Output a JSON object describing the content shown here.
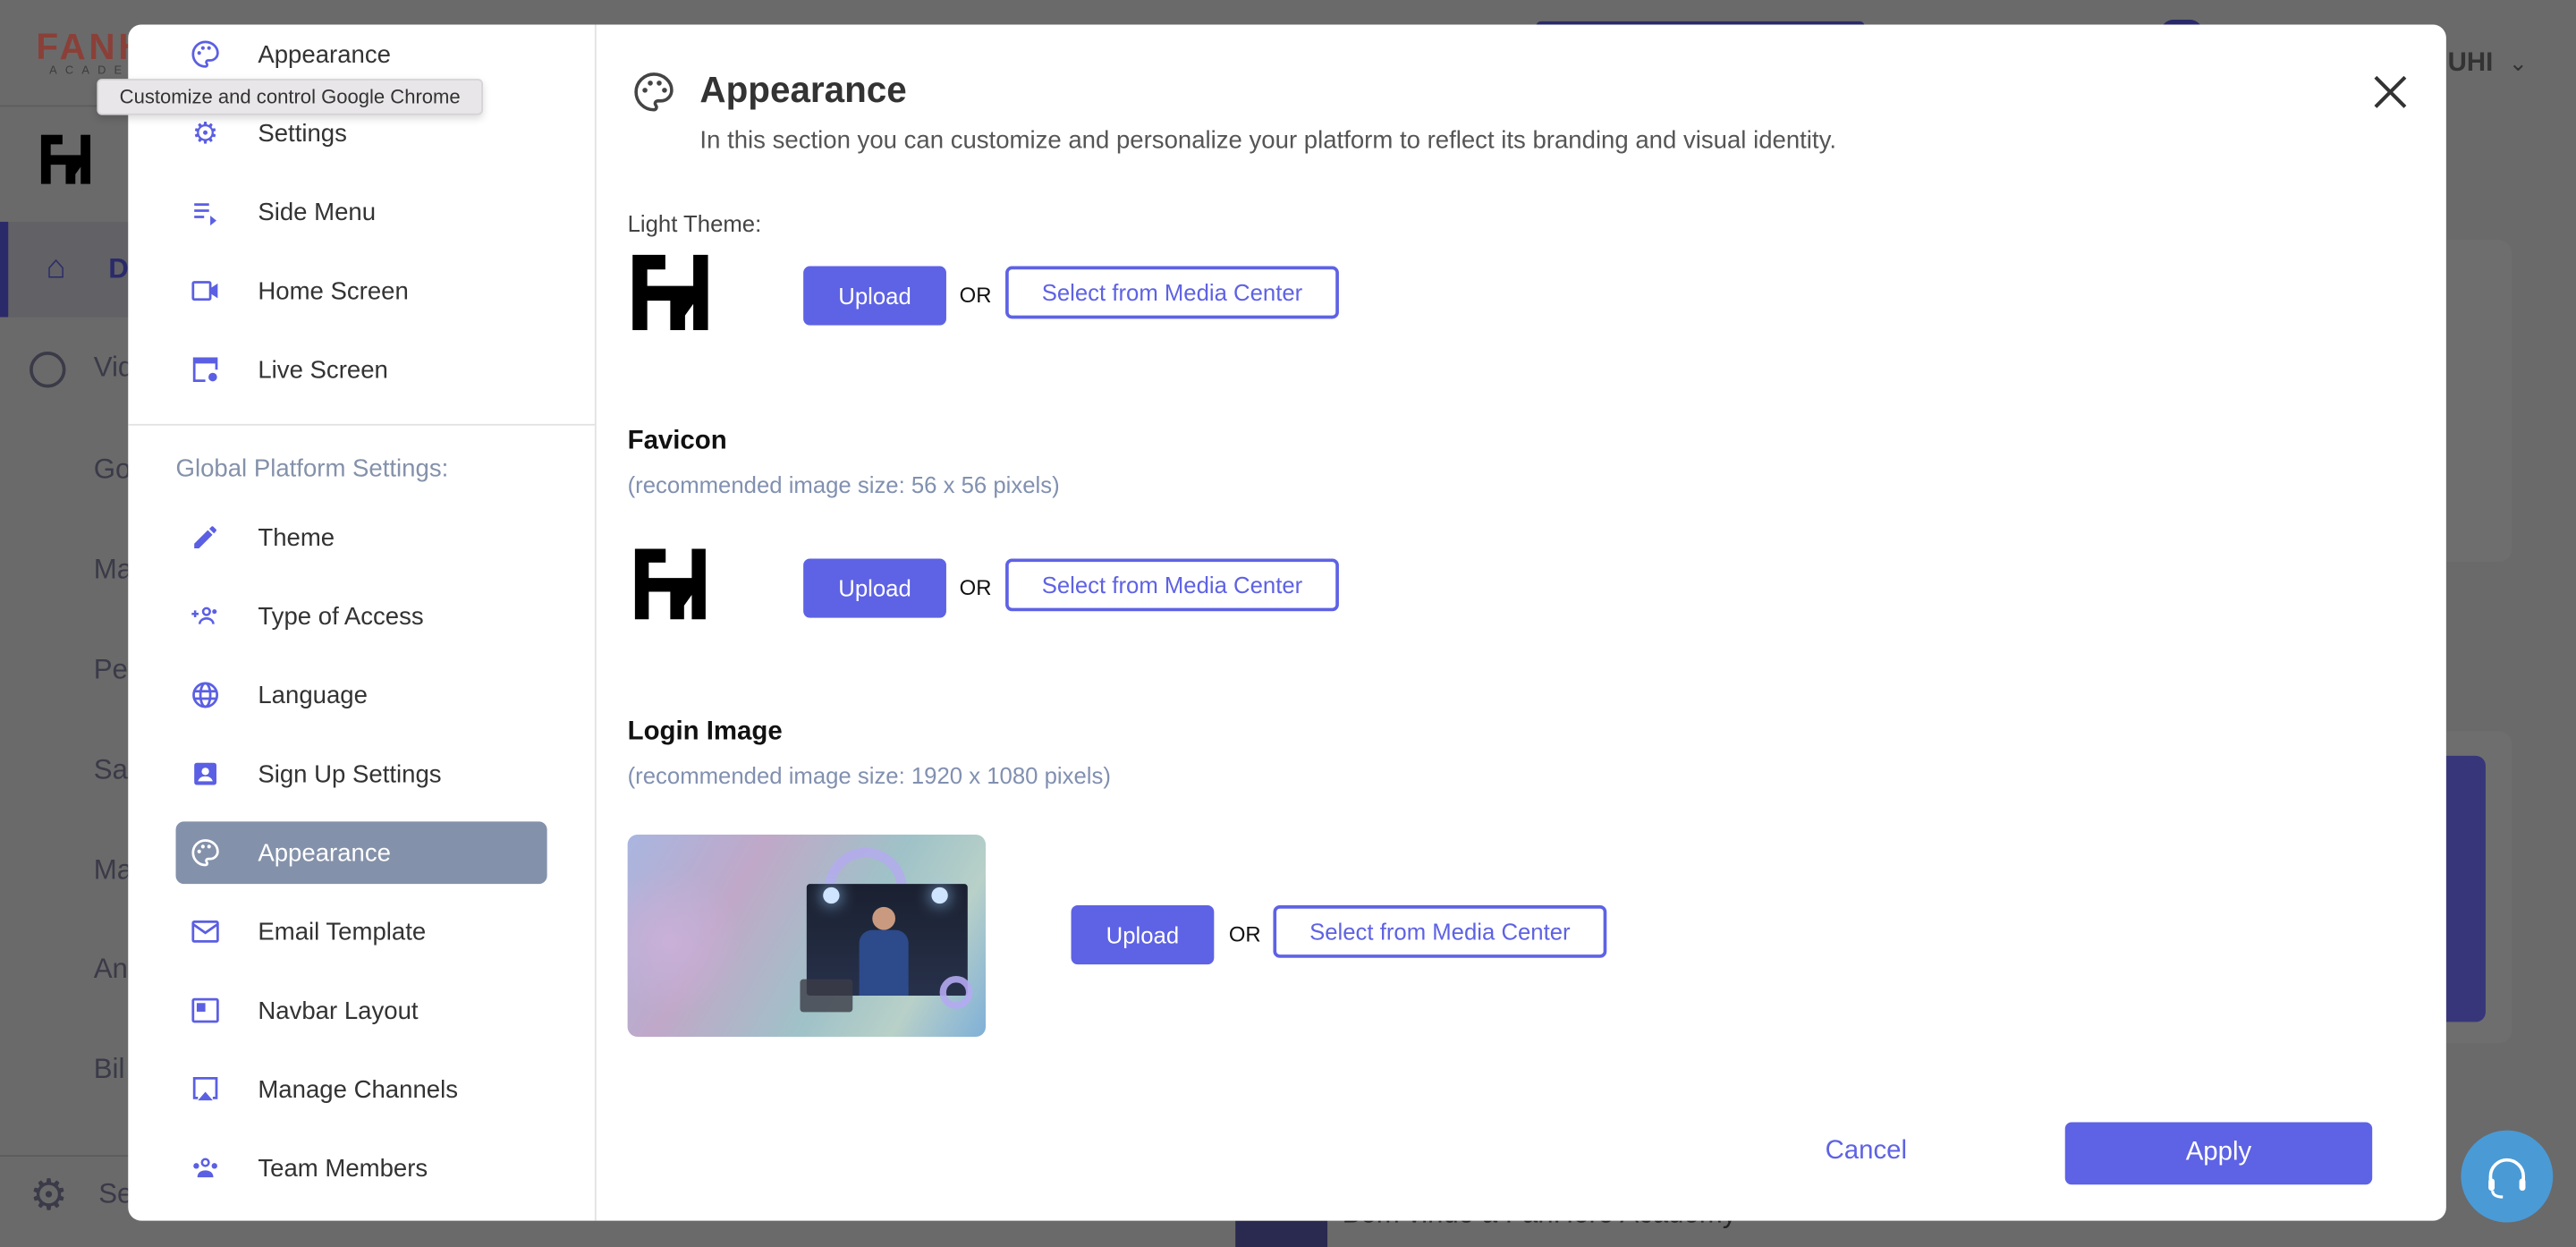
{
  "background": {
    "brand_logo_text": "FANH",
    "brand_logo_sub": "ACADEM",
    "nav_partials": [
      "D",
      "Vid",
      "Go",
      "Ma",
      "Peo",
      "Sal",
      "Ma",
      "An",
      "Bil",
      "Se"
    ],
    "user_name_partial": "UHI",
    "welcome_text": "Bem vindo à FanHero Academy"
  },
  "tooltip": "Customize and control Google Chrome",
  "sidebar": {
    "top_items": [
      {
        "label": "Appearance",
        "icon": "palette-icon"
      },
      {
        "label": "Settings",
        "icon": "gear-icon"
      },
      {
        "label": "Side Menu",
        "icon": "playlist-icon"
      },
      {
        "label": "Home Screen",
        "icon": "video-camera-icon"
      },
      {
        "label": "Live Screen",
        "icon": "window-settings-icon"
      }
    ],
    "section_title": "Global Platform Settings:",
    "items": [
      {
        "label": "Theme",
        "icon": "pencil-icon"
      },
      {
        "label": "Type of Access",
        "icon": "add-group-icon"
      },
      {
        "label": "Language",
        "icon": "globe-icon"
      },
      {
        "label": "Sign Up Settings",
        "icon": "contact-card-icon"
      },
      {
        "label": "Appearance",
        "icon": "palette-icon",
        "selected": true
      },
      {
        "label": "Email Template",
        "icon": "mail-icon"
      },
      {
        "label": "Navbar Layout",
        "icon": "layout-icon"
      },
      {
        "label": "Manage Channels",
        "icon": "airplay-icon"
      },
      {
        "label": "Team Members",
        "icon": "team-icon"
      }
    ]
  },
  "main": {
    "title": "Appearance",
    "subtitle": "In this section you can customize and personalize your platform to reflect its branding and visual identity.",
    "light_theme": {
      "label": "Light Theme:"
    },
    "favicon": {
      "title": "Favicon",
      "recommendation": "(recommended image size: 56 x 56 pixels)"
    },
    "login_image": {
      "title": "Login Image",
      "recommendation": "(recommended image size: 1920 x 1080 pixels)"
    },
    "upload_label": "Upload",
    "or_label": "OR",
    "select_label": "Select from Media Center",
    "cancel_label": "Cancel",
    "apply_label": "Apply"
  },
  "colors": {
    "accent": "#5e62e4",
    "selected_bg": "#8491aa",
    "help": "#4a9ad6"
  }
}
